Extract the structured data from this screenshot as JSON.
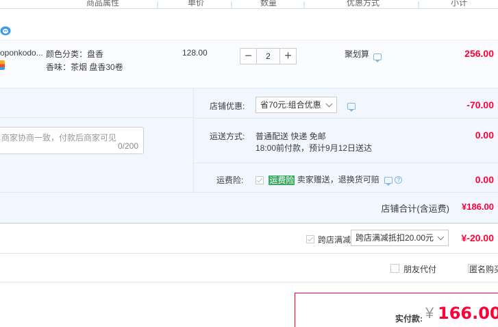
{
  "header": {
    "col_attr": "商品属性",
    "col_price": "单价",
    "col_qty": "数量",
    "col_promo": "优惠方式",
    "col_subtotal": "小计"
  },
  "item": {
    "title": "oponkodo...",
    "color_attr": "颜色分类：盘香",
    "scent_attr": "香味：茶烟 盘香30卷",
    "price": "128.00",
    "quantity": "2",
    "minus": "−",
    "plus": "+",
    "promo": "聚划算",
    "subtotal": "256.00"
  },
  "message": {
    "placeholder": "商家协商一致，付款后商家可见",
    "counter": "0/200"
  },
  "shop_discount": {
    "label": "店铺优惠:",
    "selected": "省70元:组合优惠",
    "amount": "-70.00"
  },
  "shipping": {
    "label": "运送方式:",
    "line1": "普通配送 快递 免邮",
    "line2": "18:00前付款，预计9月12日送达",
    "amount": "0.00"
  },
  "insurance": {
    "label": "运费险:",
    "tag": "运费险",
    "desc": "卖家赠送，退换货可赔",
    "help": "?",
    "amount": "0.00"
  },
  "shop_total": {
    "label": "店铺合计(含运费)",
    "value": "¥186.00"
  },
  "cross_shop": {
    "label": "跨店满减",
    "selected": "跨店满减抵扣20.00元",
    "amount": "¥-20.00"
  },
  "options": {
    "friend_pay": "朋友代付",
    "anonymous": "匿名购买"
  },
  "payment": {
    "label": "实付款:",
    "currency": "¥",
    "value": "166.00"
  },
  "colors": {
    "accent_red": "#ff0036",
    "panel_blue": "#f2f7ff",
    "insurance_green": "#3aa863"
  }
}
